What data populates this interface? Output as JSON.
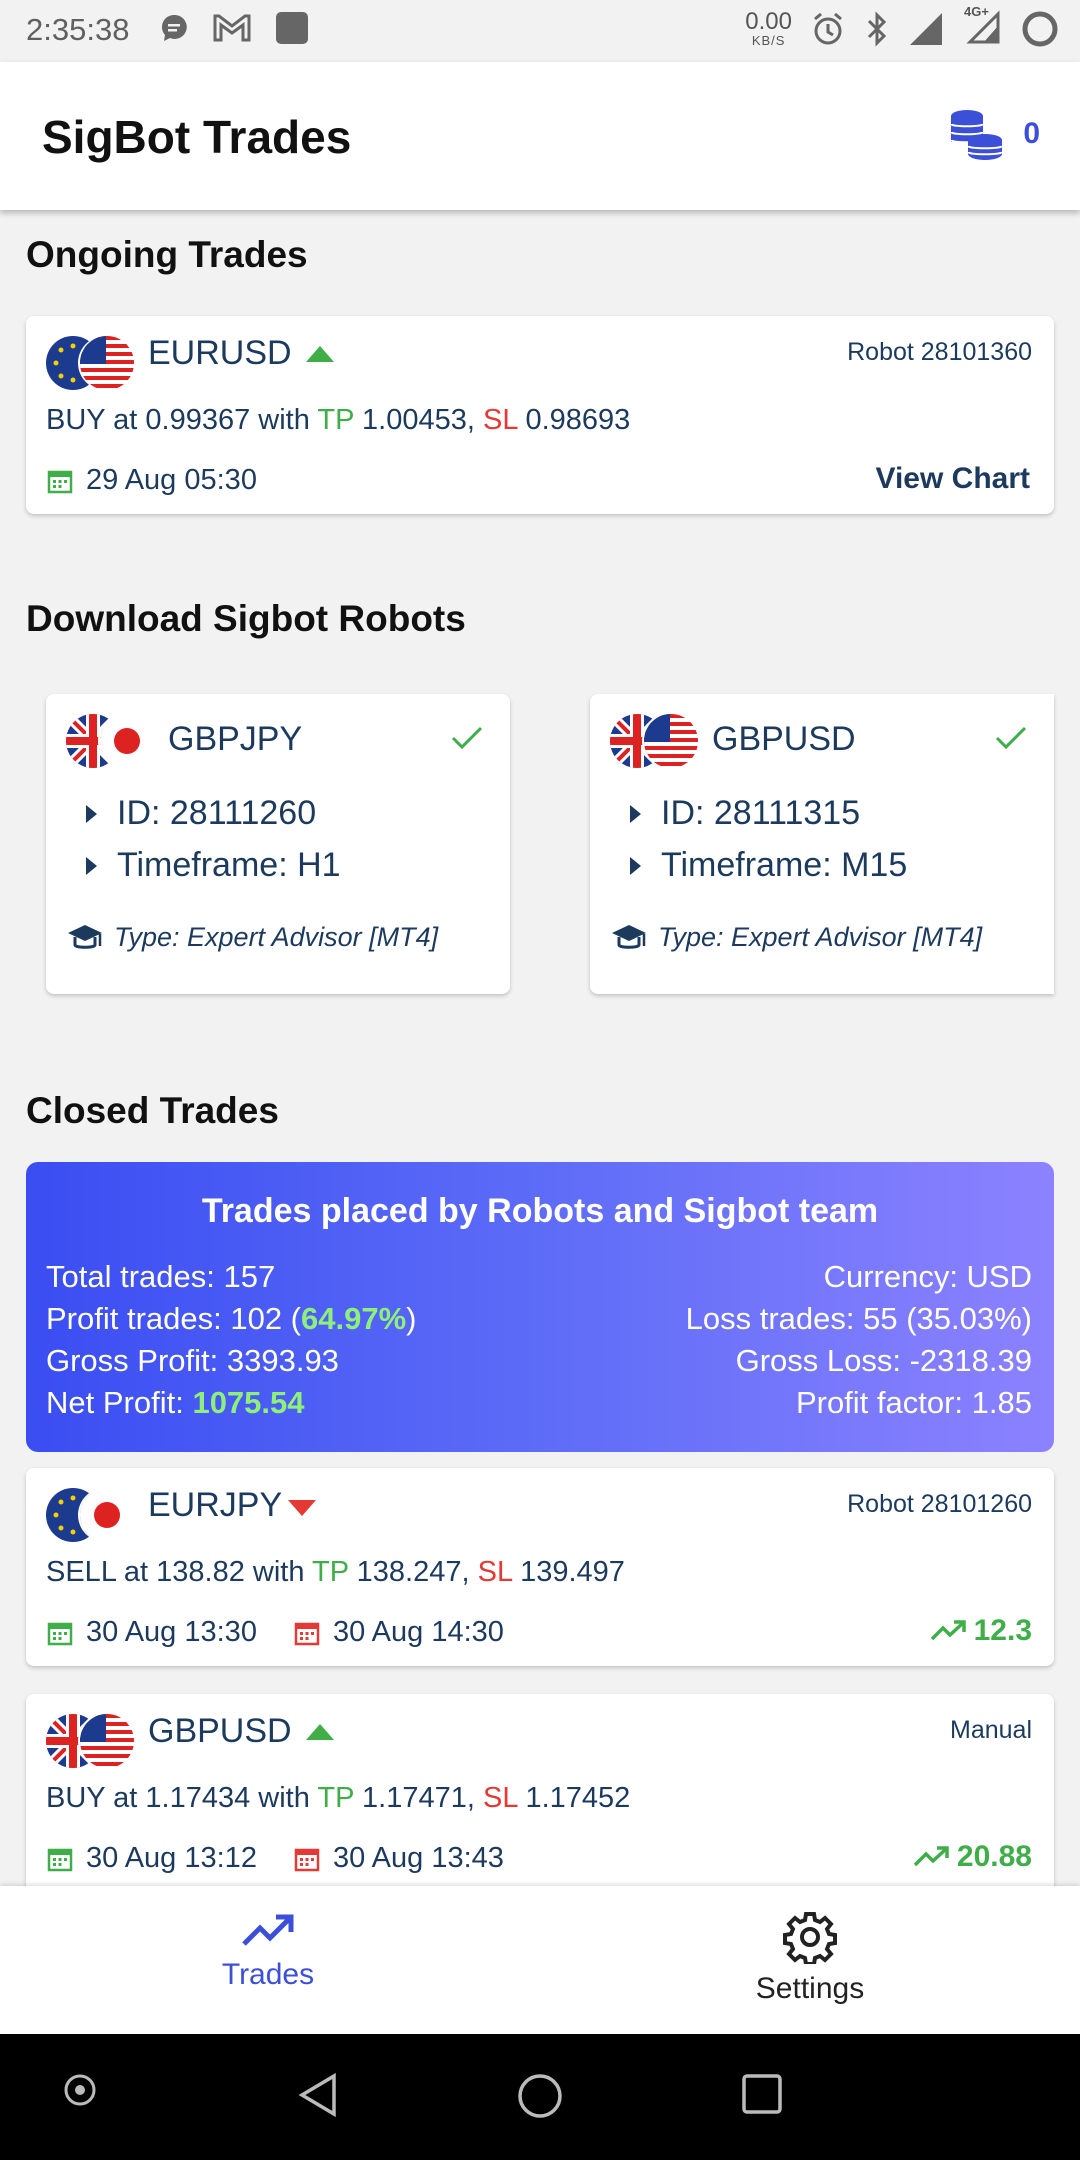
{
  "status_bar": {
    "time": "2:35:38",
    "net_speed": "0.00",
    "net_unit": "KB/S",
    "network": "4G+"
  },
  "app_bar": {
    "title": "SigBot Trades",
    "coins": "0"
  },
  "ongoing": {
    "title": "Ongoing Trades",
    "trade": {
      "pair": "EURUSD",
      "source": "Robot 28101360",
      "action": "BUY at 0.99367 with",
      "tp_label": "TP",
      "tp": "1.00453,",
      "sl_label": "SL",
      "sl": "0.98693",
      "open_date": "29 Aug 05:30",
      "view_chart": "View Chart"
    }
  },
  "robots": {
    "title": "Download Sigbot Robots",
    "items": [
      {
        "pair": "GBPJPY",
        "id": "ID: 28111260",
        "timeframe": "Timeframe: H1",
        "type": "Type: Expert Advisor [MT4]"
      },
      {
        "pair": "GBPUSD",
        "id": "ID: 28111315",
        "timeframe": "Timeframe: M15",
        "type": "Type: Expert Advisor [MT4]"
      }
    ]
  },
  "closed": {
    "title": "Closed Trades",
    "summary": {
      "title": "Trades placed by Robots and Sigbot team",
      "total": "Total trades: 157",
      "profit_trades_prefix": "Profit trades: 102 (",
      "profit_trades_pct": "64.97%",
      "profit_trades_suffix": ")",
      "gross_profit": "Gross Profit: 3393.93",
      "net_profit_label": "Net Profit:",
      "net_profit": "1075.54",
      "currency": "Currency: USD",
      "loss_trades": "Loss trades: 55 (35.03%)",
      "gross_loss": "Gross Loss: -2318.39",
      "profit_factor": "Profit factor: 1.85"
    },
    "trades": [
      {
        "pair": "EURJPY",
        "source": "Robot 28101260",
        "action": "SELL at 138.82 with",
        "tp_label": "TP",
        "tp": "138.247,",
        "sl_label": "SL",
        "sl": "139.497",
        "open_date": "30 Aug 13:30",
        "close_date": "30 Aug 14:30",
        "profit": "12.3"
      },
      {
        "pair": "GBPUSD",
        "source": "Manual",
        "action": "BUY at 1.17434 with",
        "tp_label": "TP",
        "tp": "1.17471,",
        "sl_label": "SL",
        "sl": "1.17452",
        "open_date": "30 Aug 13:12",
        "close_date": "30 Aug 13:43",
        "profit": "20.88"
      }
    ]
  },
  "bottom_nav": {
    "trades": "Trades",
    "settings": "Settings"
  },
  "colors": {
    "accent": "#3b4fd8",
    "profit": "#3fae49",
    "loss": "#e53935",
    "text_navy": "#1c3a5e"
  }
}
